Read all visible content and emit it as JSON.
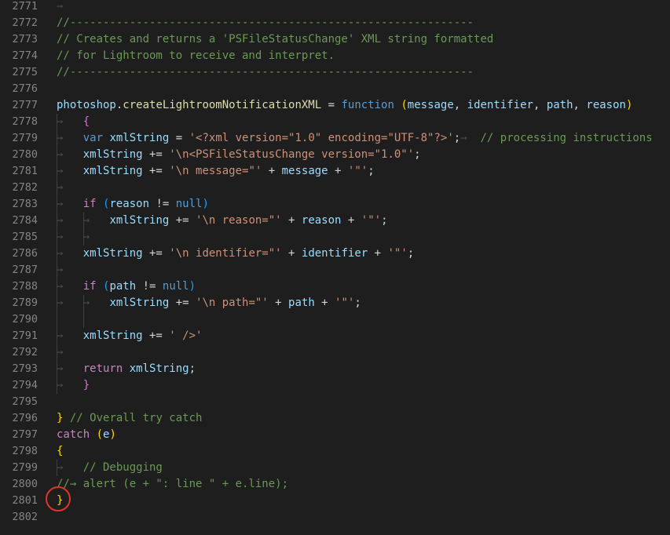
{
  "editor": {
    "lines": [
      {
        "num": "2771",
        "indent": 0,
        "tokens": [
          {
            "t": "→",
            "c": "ws"
          }
        ]
      },
      {
        "num": "2772",
        "indent": 0,
        "tokens": [
          {
            "t": "//-------------------------------------------------------------",
            "c": "c"
          }
        ]
      },
      {
        "num": "2773",
        "indent": 0,
        "tokens": [
          {
            "t": "// Creates and returns a 'PSFileStatusChange' XML string formatted",
            "c": "c"
          }
        ]
      },
      {
        "num": "2774",
        "indent": 0,
        "tokens": [
          {
            "t": "// for Lightroom to receive and interpret.",
            "c": "c"
          }
        ]
      },
      {
        "num": "2775",
        "indent": 0,
        "tokens": [
          {
            "t": "//-------------------------------------------------------------",
            "c": "c"
          }
        ]
      },
      {
        "num": "2776",
        "indent": 0,
        "tokens": []
      },
      {
        "num": "2777",
        "indent": 0,
        "tokens": [
          {
            "t": "photoshop",
            "c": "v"
          },
          {
            "t": ".",
            "c": "o"
          },
          {
            "t": "createLightroomNotificationXML",
            "c": "f"
          },
          {
            "t": " = ",
            "c": "o"
          },
          {
            "t": "function",
            "c": "kw"
          },
          {
            "t": " ",
            "c": "o"
          },
          {
            "t": "(",
            "c": "b1"
          },
          {
            "t": "message",
            "c": "v"
          },
          {
            "t": ", ",
            "c": "o"
          },
          {
            "t": "identifier",
            "c": "v"
          },
          {
            "t": ", ",
            "c": "o"
          },
          {
            "t": "path",
            "c": "v"
          },
          {
            "t": ", ",
            "c": "o"
          },
          {
            "t": "reason",
            "c": "v"
          },
          {
            "t": ")",
            "c": "b1"
          }
        ]
      },
      {
        "num": "2778",
        "indent": 1,
        "tokens": [
          {
            "t": "→   ",
            "c": "ws"
          },
          {
            "t": "{",
            "c": "b2"
          }
        ]
      },
      {
        "num": "2779",
        "indent": 1,
        "tokens": [
          {
            "t": "→   ",
            "c": "ws"
          },
          {
            "t": "var",
            "c": "kw"
          },
          {
            "t": " ",
            "c": "o"
          },
          {
            "t": "xmlString",
            "c": "v"
          },
          {
            "t": " = ",
            "c": "o"
          },
          {
            "t": "'<?xml version=\"1.0\" encoding=\"UTF-8\"?>'",
            "c": "s"
          },
          {
            "t": ";",
            "c": "o"
          },
          {
            "t": "→  ",
            "c": "ws"
          },
          {
            "t": "// processing instructions",
            "c": "c"
          }
        ]
      },
      {
        "num": "2780",
        "indent": 1,
        "tokens": [
          {
            "t": "→   ",
            "c": "ws"
          },
          {
            "t": "xmlString",
            "c": "v"
          },
          {
            "t": " += ",
            "c": "o"
          },
          {
            "t": "'\\n<PSFileStatusChange version=\"1.0\"'",
            "c": "s"
          },
          {
            "t": ";",
            "c": "o"
          }
        ]
      },
      {
        "num": "2781",
        "indent": 1,
        "tokens": [
          {
            "t": "→   ",
            "c": "ws"
          },
          {
            "t": "xmlString",
            "c": "v"
          },
          {
            "t": " += ",
            "c": "o"
          },
          {
            "t": "'\\n message=\"'",
            "c": "s"
          },
          {
            "t": " + ",
            "c": "o"
          },
          {
            "t": "message",
            "c": "v"
          },
          {
            "t": " + ",
            "c": "o"
          },
          {
            "t": "'\"'",
            "c": "s"
          },
          {
            "t": ";",
            "c": "o"
          }
        ]
      },
      {
        "num": "2782",
        "indent": 1,
        "tokens": [
          {
            "t": "→",
            "c": "ws"
          }
        ]
      },
      {
        "num": "2783",
        "indent": 1,
        "tokens": [
          {
            "t": "→   ",
            "c": "ws"
          },
          {
            "t": "if",
            "c": "k"
          },
          {
            "t": " ",
            "c": "o"
          },
          {
            "t": "(",
            "c": "b3"
          },
          {
            "t": "reason",
            "c": "v"
          },
          {
            "t": " != ",
            "c": "o"
          },
          {
            "t": "null",
            "c": "kw"
          },
          {
            "t": ")",
            "c": "b3"
          }
        ]
      },
      {
        "num": "2784",
        "indent": 2,
        "tokens": [
          {
            "t": "→   →   ",
            "c": "ws"
          },
          {
            "t": "xmlString",
            "c": "v"
          },
          {
            "t": " += ",
            "c": "o"
          },
          {
            "t": "'\\n reason=\"'",
            "c": "s"
          },
          {
            "t": " + ",
            "c": "o"
          },
          {
            "t": "reason",
            "c": "v"
          },
          {
            "t": " + ",
            "c": "o"
          },
          {
            "t": "'\"'",
            "c": "s"
          },
          {
            "t": ";",
            "c": "o"
          }
        ]
      },
      {
        "num": "2785",
        "indent": 2,
        "tokens": [
          {
            "t": "→   →",
            "c": "ws"
          }
        ]
      },
      {
        "num": "2786",
        "indent": 1,
        "tokens": [
          {
            "t": "→   ",
            "c": "ws"
          },
          {
            "t": "xmlString",
            "c": "v"
          },
          {
            "t": " += ",
            "c": "o"
          },
          {
            "t": "'\\n identifier=\"'",
            "c": "s"
          },
          {
            "t": " + ",
            "c": "o"
          },
          {
            "t": "identifier",
            "c": "v"
          },
          {
            "t": " + ",
            "c": "o"
          },
          {
            "t": "'\"'",
            "c": "s"
          },
          {
            "t": ";",
            "c": "o"
          }
        ]
      },
      {
        "num": "2787",
        "indent": 1,
        "tokens": [
          {
            "t": "→",
            "c": "ws"
          }
        ]
      },
      {
        "num": "2788",
        "indent": 1,
        "tokens": [
          {
            "t": "→   ",
            "c": "ws"
          },
          {
            "t": "if",
            "c": "k"
          },
          {
            "t": " ",
            "c": "o"
          },
          {
            "t": "(",
            "c": "b3"
          },
          {
            "t": "path",
            "c": "v"
          },
          {
            "t": " != ",
            "c": "o"
          },
          {
            "t": "null",
            "c": "kw"
          },
          {
            "t": ")",
            "c": "b3"
          }
        ]
      },
      {
        "num": "2789",
        "indent": 2,
        "tokens": [
          {
            "t": "→   →   ",
            "c": "ws"
          },
          {
            "t": "xmlString",
            "c": "v"
          },
          {
            "t": " += ",
            "c": "o"
          },
          {
            "t": "'\\n path=\"'",
            "c": "s"
          },
          {
            "t": " + ",
            "c": "o"
          },
          {
            "t": "path",
            "c": "v"
          },
          {
            "t": " + ",
            "c": "o"
          },
          {
            "t": "'\"'",
            "c": "s"
          },
          {
            "t": ";",
            "c": "o"
          }
        ]
      },
      {
        "num": "2790",
        "indent": 2,
        "tokens": []
      },
      {
        "num": "2791",
        "indent": 1,
        "tokens": [
          {
            "t": "→   ",
            "c": "ws"
          },
          {
            "t": "xmlString",
            "c": "v"
          },
          {
            "t": " += ",
            "c": "o"
          },
          {
            "t": "' />'",
            "c": "s"
          }
        ]
      },
      {
        "num": "2792",
        "indent": 1,
        "tokens": [
          {
            "t": "→",
            "c": "ws"
          }
        ]
      },
      {
        "num": "2793",
        "indent": 1,
        "tokens": [
          {
            "t": "→   ",
            "c": "ws"
          },
          {
            "t": "return",
            "c": "k"
          },
          {
            "t": " ",
            "c": "o"
          },
          {
            "t": "xmlString",
            "c": "v"
          },
          {
            "t": ";",
            "c": "o"
          }
        ]
      },
      {
        "num": "2794",
        "indent": 1,
        "tokens": [
          {
            "t": "→   ",
            "c": "ws"
          },
          {
            "t": "}",
            "c": "b2"
          }
        ]
      },
      {
        "num": "2795",
        "indent": 0,
        "tokens": []
      },
      {
        "num": "2796",
        "indent": 0,
        "tokens": [
          {
            "t": "}",
            "c": "b1"
          },
          {
            "t": " ",
            "c": "o"
          },
          {
            "t": "// Overall try catch",
            "c": "c"
          }
        ]
      },
      {
        "num": "2797",
        "indent": 0,
        "tokens": [
          {
            "t": "catch",
            "c": "k"
          },
          {
            "t": " ",
            "c": "o"
          },
          {
            "t": "(",
            "c": "b1"
          },
          {
            "t": "e",
            "c": "v"
          },
          {
            "t": ")",
            "c": "b1"
          }
        ]
      },
      {
        "num": "2798",
        "indent": 0,
        "tokens": [
          {
            "t": "{",
            "c": "b1"
          }
        ]
      },
      {
        "num": "2799",
        "indent": 1,
        "tokens": [
          {
            "t": "→   ",
            "c": "ws"
          },
          {
            "t": "// Debugging",
            "c": "c"
          }
        ]
      },
      {
        "num": "2800",
        "indent": 0,
        "tokens": [
          {
            "t": "//→ alert (e + \": line \" + e.line);",
            "c": "c"
          }
        ]
      },
      {
        "num": "2801",
        "indent": 0,
        "tokens": [
          {
            "t": "}",
            "c": "b1"
          }
        ]
      },
      {
        "num": "2802",
        "indent": 0,
        "tokens": []
      }
    ]
  },
  "annotation": {
    "marker_color": "#e0352a",
    "marker_line": "2801"
  }
}
